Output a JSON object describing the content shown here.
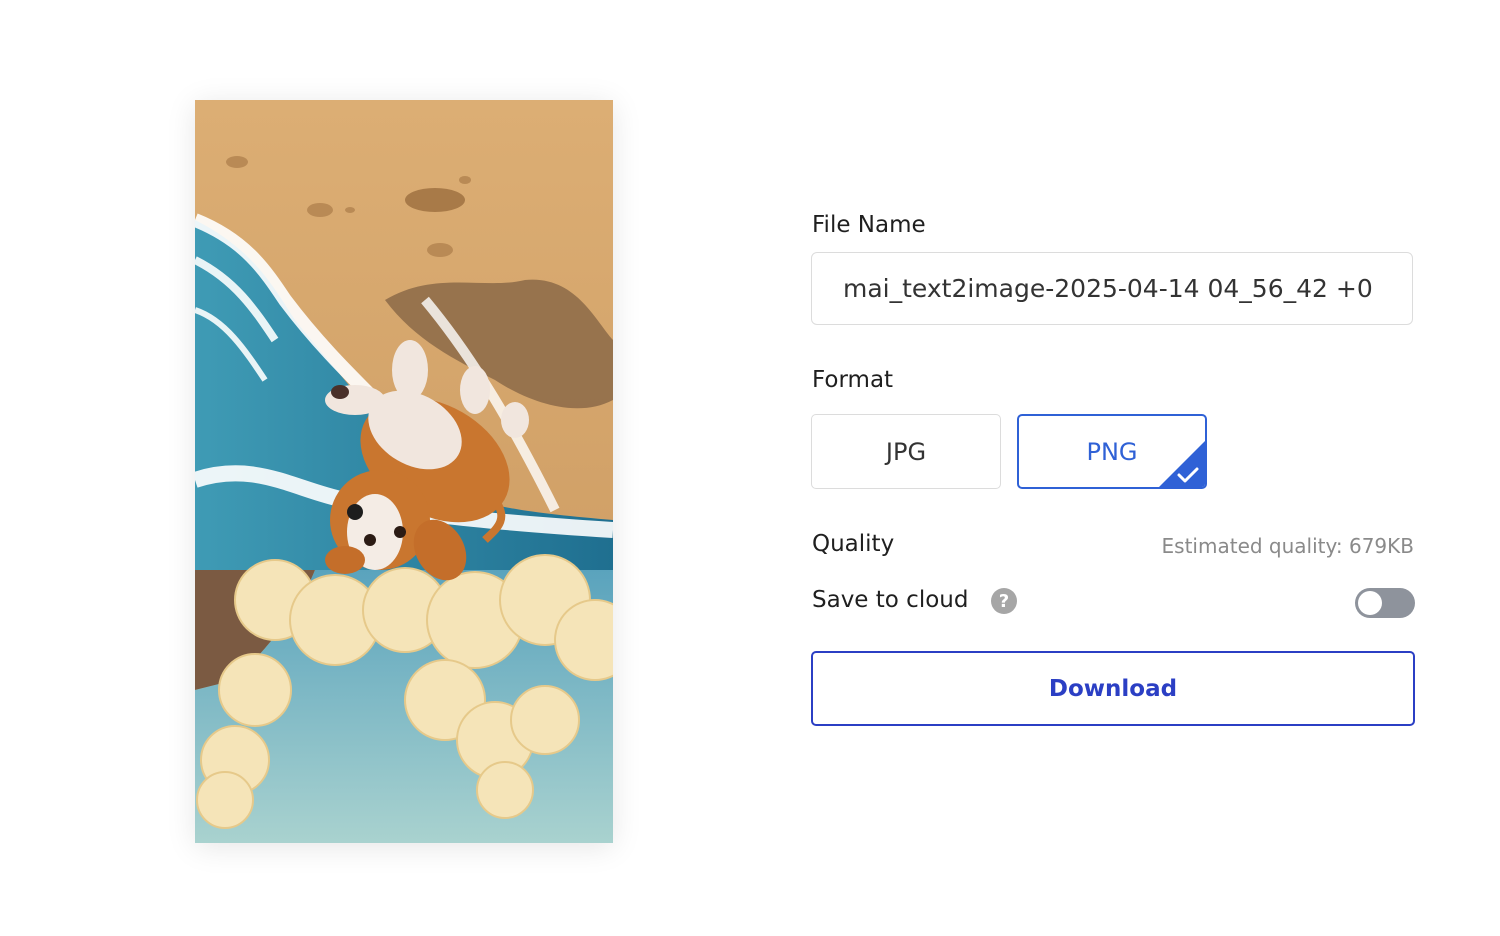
{
  "preview": {
    "subject": "illustration of a puppy tumbling upside down over an ocean wave on a sandy beach"
  },
  "file_name": {
    "label": "File Name",
    "value": "mai_text2image-2025-04-14 04_56_42 +0"
  },
  "format": {
    "label": "Format",
    "options": [
      "JPG",
      "PNG"
    ],
    "selected": "PNG"
  },
  "quality": {
    "label": "Quality",
    "estimate": "Estimated quality: 679KB"
  },
  "save_to_cloud": {
    "label": "Save to cloud",
    "help_glyph": "?",
    "enabled": false
  },
  "download": {
    "label": "Download"
  },
  "colors": {
    "accent": "#2f61d6",
    "download": "#2b3fc4",
    "toggle_off": "#8e939c"
  }
}
